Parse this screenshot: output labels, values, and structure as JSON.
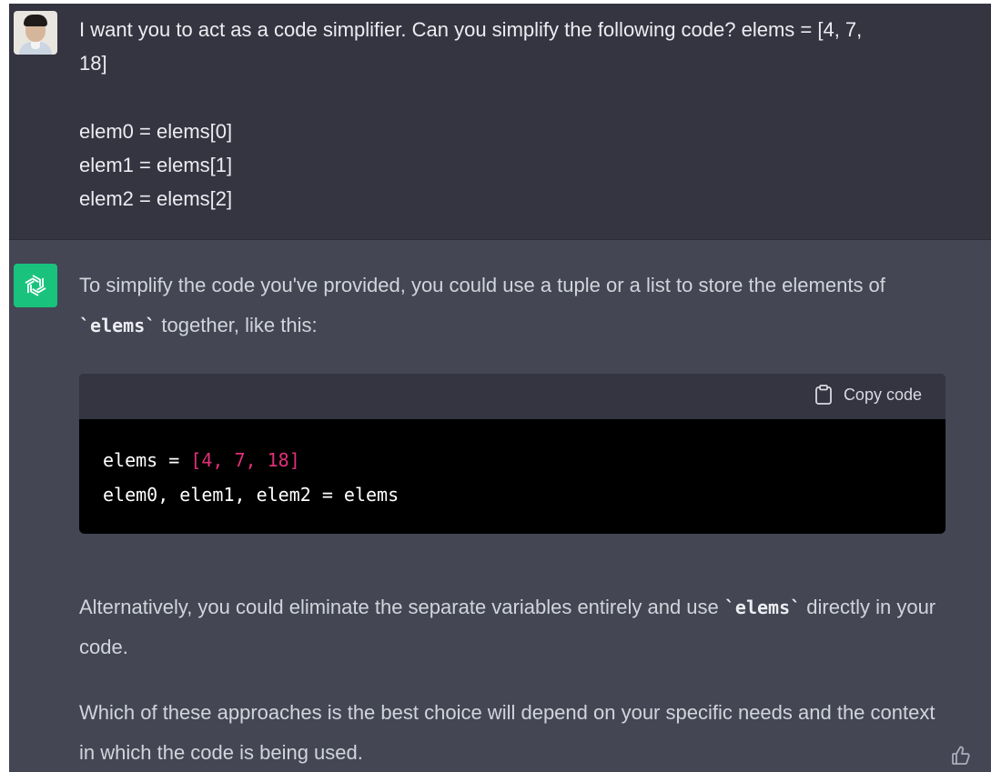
{
  "user": {
    "message_line1": "I want you to act as a code simplifier. Can you simplify the following code? elems = [4, 7,",
    "message_line2": "18]",
    "code_lines": [
      "elem0 = elems[0]",
      "elem1 = elems[1]",
      "elem2 = elems[2]"
    ]
  },
  "assistant": {
    "para1_before": "To simplify the code you've provided, you could use a tuple or a list to store the elements of ",
    "para1_code": "`elems`",
    "para1_after": " together, like this:",
    "copy_label": "Copy code",
    "code": {
      "line1_name": "elems",
      "line1_op": " = ",
      "line1_list": "[4, 7, 18]",
      "line2": "elem0, elem1, elem2 = elems"
    },
    "para2_before": "Alternatively, you could eliminate the separate variables entirely and use ",
    "para2_code": "`elems`",
    "para2_after": " directly in your code.",
    "para3": "Which of these approaches is the best choice will depend on your specific needs and the context in which the code is being used."
  },
  "icons": {
    "user_avatar": "user-avatar",
    "assistant_logo": "openai-logo-icon",
    "copy": "clipboard-icon",
    "feedback": "thumbs-up-icon"
  },
  "colors": {
    "user_bg": "#343541",
    "assistant_bg": "#444654",
    "bot_accent": "#19c37d",
    "code_list": "#df3079"
  }
}
